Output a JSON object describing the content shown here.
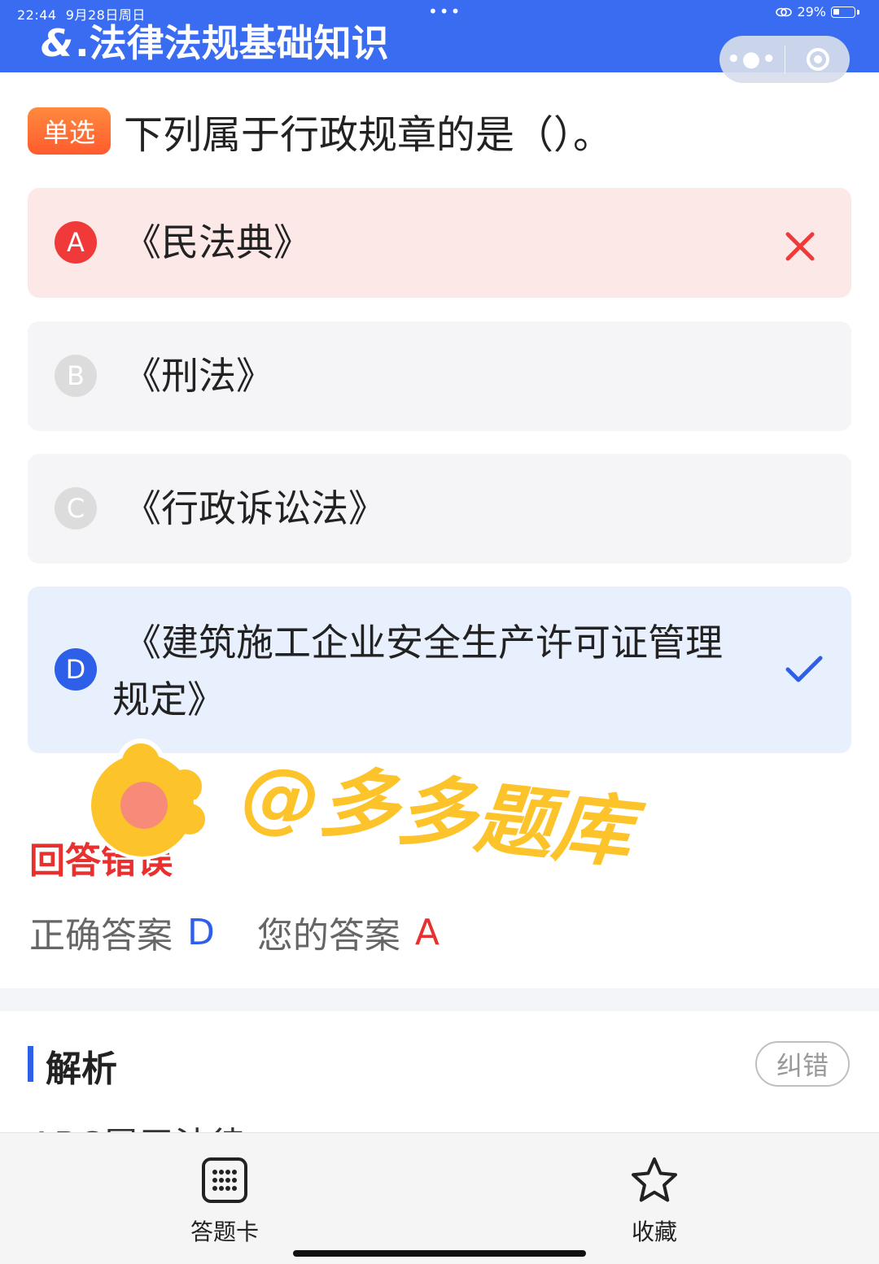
{
  "status_bar": {
    "time": "22:44",
    "date": "9月28日周日",
    "dots": "•••",
    "battery": "29%"
  },
  "header": {
    "logo": "&",
    "title": ".法律法规基础知识"
  },
  "question": {
    "type_tag": "单选",
    "text": "下列属于行政规章的是（）。",
    "options": [
      {
        "letter": "A",
        "text": "《民法典》",
        "state": "wrong"
      },
      {
        "letter": "B",
        "text": "《刑法》",
        "state": "normal"
      },
      {
        "letter": "C",
        "text": "《行政诉讼法》",
        "state": "normal"
      },
      {
        "letter": "D",
        "text_line1": "《建筑施工企业安全生产许可证管理",
        "text_line2": "规定》",
        "state": "correct"
      }
    ]
  },
  "watermark": {
    "text": "@多多题库"
  },
  "answer": {
    "title": "回答错误",
    "correct_label": "正确答案",
    "correct_value": "D",
    "yours_label": "您的答案",
    "yours_value": "A"
  },
  "analysis": {
    "title": "解析",
    "report_button": "纠错",
    "text": "ABC属于法律"
  },
  "bottom_nav": {
    "items": [
      {
        "label": "答题卡",
        "icon": "grid-card-icon"
      },
      {
        "label": "收藏",
        "icon": "star-icon"
      }
    ]
  },
  "colors": {
    "accent": "#3a6cf2",
    "wrong": "#f03a3a",
    "correct": "#2e5fe8",
    "tag": "#ff6a33"
  }
}
